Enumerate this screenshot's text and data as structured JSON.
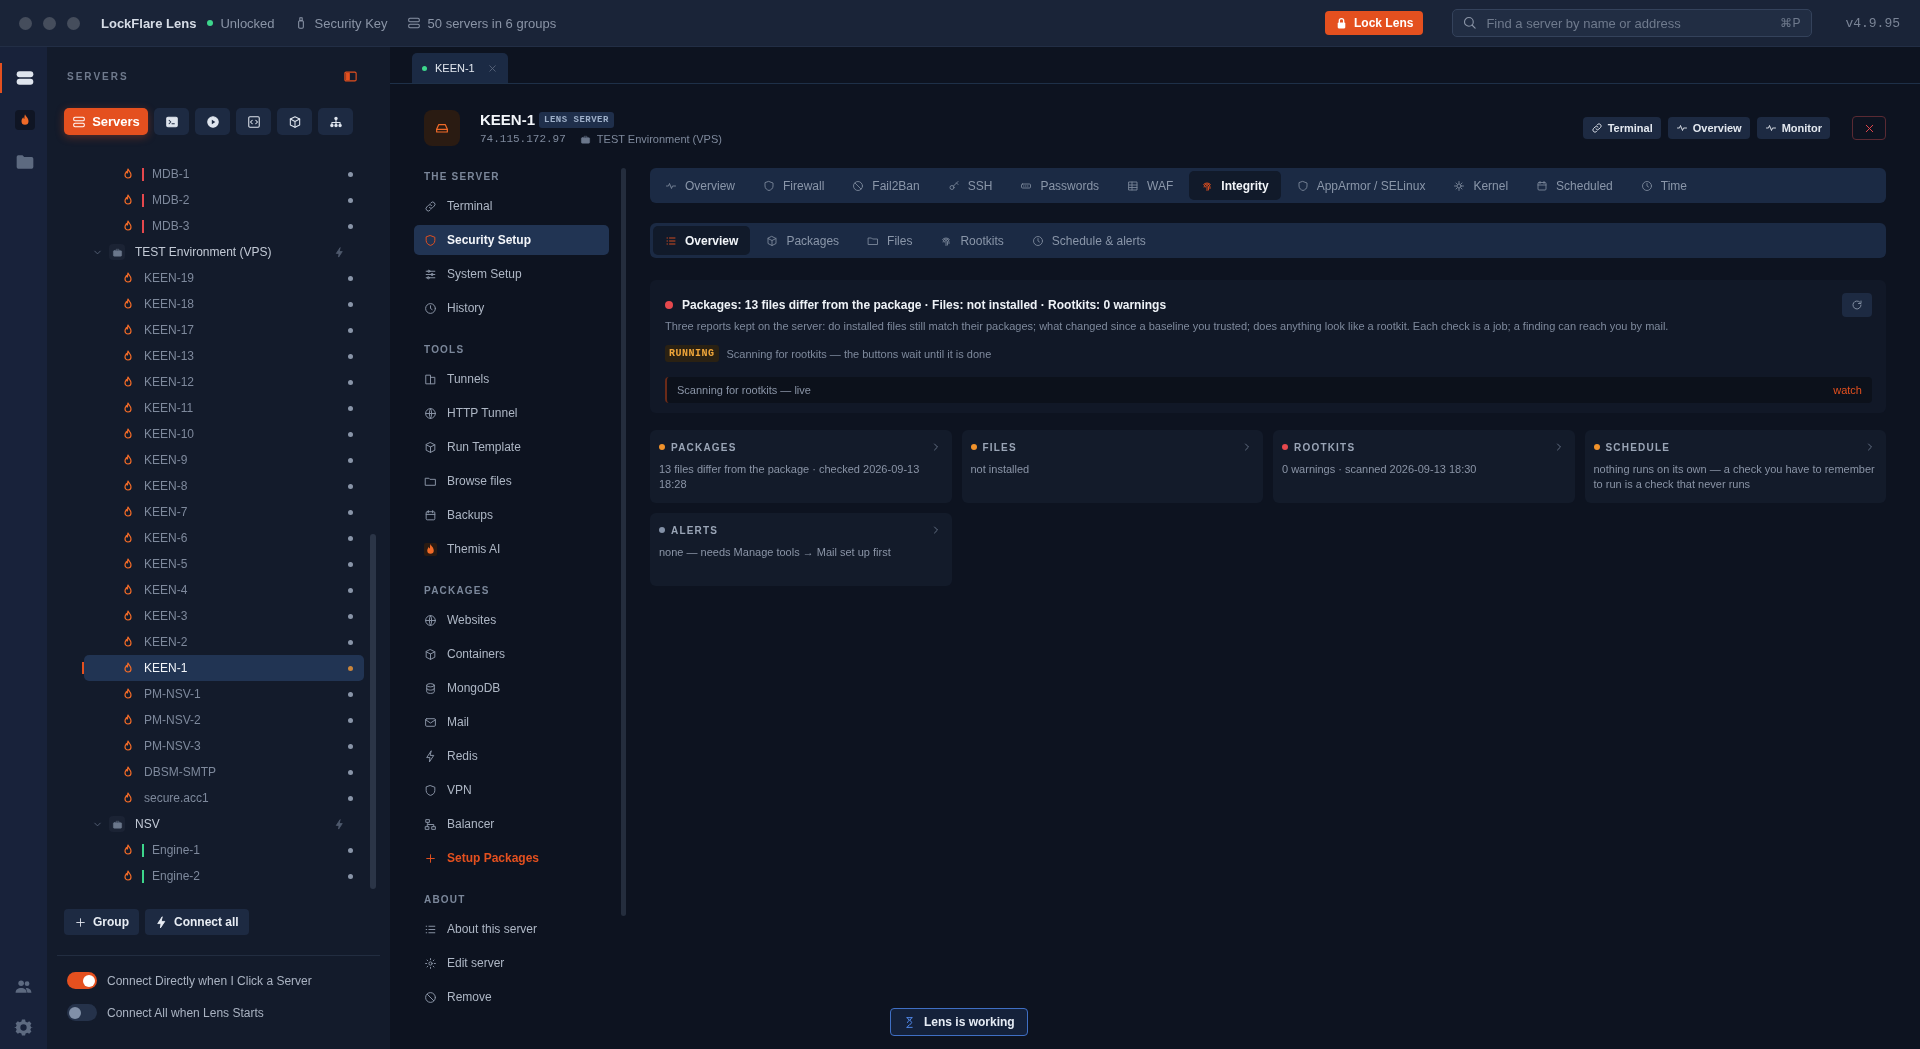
{
  "titlebar": {
    "app_name": "LockFlare Lens",
    "lock_status": "Unlocked",
    "security_key": "Security Key",
    "servers_summary": "50 servers in 6 groups",
    "lock_button": "Lock Lens",
    "search": {
      "placeholder": "Find a server by name or address",
      "shortcut": "⌘P"
    },
    "version": "v4.9.95"
  },
  "rail": [
    {
      "selected": true
    },
    {
      "selected": false
    },
    {
      "selected": false
    }
  ],
  "sidebar": {
    "title": "SERVERS",
    "tabs": [
      {
        "label": "Servers",
        "selected": true
      },
      {
        "selected": false
      },
      {
        "selected": false
      },
      {
        "selected": false
      },
      {
        "selected": false
      },
      {
        "selected": false
      }
    ],
    "tree": [
      {
        "kind": "server",
        "name": "MDB-1",
        "color": "#e5484d",
        "selected": false
      },
      {
        "kind": "server",
        "name": "MDB-2",
        "color": "#e5484d",
        "selected": false
      },
      {
        "kind": "server",
        "name": "MDB-3",
        "color": "#e5484d",
        "selected": false
      },
      {
        "kind": "group",
        "name": "TEST Environment (VPS)",
        "expanded": true,
        "children": [
          {
            "kind": "server",
            "name": "KEEN-19",
            "selected": false
          },
          {
            "kind": "server",
            "name": "KEEN-18",
            "selected": false
          },
          {
            "kind": "server",
            "name": "KEEN-17",
            "selected": false
          },
          {
            "kind": "server",
            "name": "KEEN-13",
            "selected": false
          },
          {
            "kind": "server",
            "name": "KEEN-12",
            "selected": false
          },
          {
            "kind": "server",
            "name": "KEEN-11",
            "selected": false
          },
          {
            "kind": "server",
            "name": "KEEN-10",
            "selected": false
          },
          {
            "kind": "server",
            "name": "KEEN-9",
            "selected": false
          },
          {
            "kind": "server",
            "name": "KEEN-8",
            "selected": false
          },
          {
            "kind": "server",
            "name": "KEEN-7",
            "selected": false
          },
          {
            "kind": "server",
            "name": "KEEN-6",
            "selected": false
          },
          {
            "kind": "server",
            "name": "KEEN-5",
            "selected": false
          },
          {
            "kind": "server",
            "name": "KEEN-4",
            "selected": false
          },
          {
            "kind": "server",
            "name": "KEEN-3",
            "selected": false
          },
          {
            "kind": "server",
            "name": "KEEN-2",
            "selected": false
          },
          {
            "kind": "server",
            "name": "KEEN-1",
            "selected": true
          },
          {
            "kind": "server",
            "name": "PM-NSV-1",
            "selected": false
          },
          {
            "kind": "server",
            "name": "PM-NSV-2",
            "selected": false
          },
          {
            "kind": "server",
            "name": "PM-NSV-3",
            "selected": false
          },
          {
            "kind": "server",
            "name": "DBSM-SMTP",
            "selected": false
          },
          {
            "kind": "server",
            "name": "secure.acc1",
            "selected": false
          }
        ]
      },
      {
        "kind": "group",
        "name": "NSV",
        "expanded": true,
        "children": [
          {
            "kind": "server",
            "name": "Engine-1",
            "color": "#3dd68c",
            "selected": false
          },
          {
            "kind": "server",
            "name": "Engine-2",
            "color": "#3dd68c",
            "selected": false
          }
        ]
      }
    ],
    "buttons": [
      "Group",
      "Connect all"
    ],
    "toggles": [
      {
        "label": "Connect Directly when I Click a Server",
        "on": true
      },
      {
        "label": "Connect All when Lens Starts",
        "on": false
      }
    ]
  },
  "open_tabs": [
    {
      "label": "KEEN-1",
      "selected": true
    }
  ],
  "server": {
    "name": "KEEN-1",
    "badge": "LENS SERVER",
    "address": "74.115.172.97",
    "group": "TEST Environment (VPS)",
    "actions": [
      "Terminal",
      "Overview",
      "Monitor"
    ]
  },
  "nav": [
    {
      "heading": "THE SERVER",
      "items": [
        {
          "label": "Terminal",
          "kind": "link",
          "selected": false
        },
        {
          "label": "Security Setup",
          "kind": "link",
          "selected": true
        },
        {
          "label": "System Setup",
          "kind": "link",
          "selected": false
        },
        {
          "label": "History",
          "kind": "link",
          "selected": false
        }
      ]
    },
    {
      "heading": "TOOLS",
      "items": [
        {
          "label": "Tunnels",
          "kind": "link",
          "selected": false
        },
        {
          "label": "HTTP Tunnel",
          "kind": "link",
          "selected": false
        },
        {
          "label": "Run Template",
          "kind": "link",
          "selected": false
        },
        {
          "label": "Browse files",
          "kind": "link",
          "selected": false
        },
        {
          "label": "Backups",
          "kind": "link",
          "selected": false
        },
        {
          "label": "Themis AI",
          "kind": "link",
          "selected": false
        }
      ]
    },
    {
      "heading": "PACKAGES",
      "items": [
        {
          "label": "Websites",
          "kind": "link",
          "selected": false
        },
        {
          "label": "Containers",
          "kind": "link",
          "selected": false
        },
        {
          "label": "MongoDB",
          "kind": "link",
          "selected": false
        },
        {
          "label": "Mail",
          "kind": "link",
          "selected": false
        },
        {
          "label": "Redis",
          "kind": "link",
          "selected": false
        },
        {
          "label": "VPN",
          "kind": "link",
          "selected": false
        },
        {
          "label": "Balancer",
          "kind": "link",
          "selected": false
        },
        {
          "label": "Setup Packages",
          "kind": "action",
          "selected": false
        }
      ]
    },
    {
      "heading": "ABOUT",
      "items": [
        {
          "label": "About this server",
          "kind": "link",
          "selected": false
        },
        {
          "label": "Edit server",
          "kind": "link",
          "selected": false
        },
        {
          "label": "Remove",
          "kind": "link",
          "selected": false
        }
      ]
    }
  ],
  "security_tabs": [
    {
      "label": "Overview",
      "selected": false
    },
    {
      "label": "Firewall",
      "selected": false
    },
    {
      "label": "Fail2Ban",
      "selected": false
    },
    {
      "label": "SSH",
      "selected": false
    },
    {
      "label": "Passwords",
      "selected": false
    },
    {
      "label": "WAF",
      "selected": false
    },
    {
      "label": "Integrity",
      "selected": true
    },
    {
      "label": "AppArmor / SELinux",
      "selected": false
    },
    {
      "label": "Kernel",
      "selected": false
    },
    {
      "label": "Scheduled",
      "selected": false
    },
    {
      "label": "Time",
      "selected": false
    }
  ],
  "integrity_tabs": [
    {
      "label": "Overview",
      "selected": true
    },
    {
      "label": "Packages",
      "selected": false
    },
    {
      "label": "Files",
      "selected": false
    },
    {
      "label": "Rootkits",
      "selected": false
    },
    {
      "label": "Schedule & alerts",
      "selected": false
    }
  ],
  "summary": {
    "color": "#e5484d",
    "headline": "Packages: 13 files differ from the package · Files: not installed · Rootkits: 0 warnings",
    "description": "Three reports kept on the server: do installed files still match their packages; what changed since a baseline you trusted; does anything look like a rootkit. Each check is a job; a finding can reach you by mail.",
    "job_state": "RUNNING",
    "job_text": "Scanning for rootkits — the buttons wait until it is done",
    "log_line": "Scanning for rootkits — live",
    "log_action": "watch"
  },
  "cards": [
    {
      "title": "PACKAGES",
      "color": "#f0922b",
      "text": "13 files differ from the package · checked 2026-09-13 18:28"
    },
    {
      "title": "FILES",
      "color": "#f0922b",
      "text": "not installed"
    },
    {
      "title": "ROOTKITS",
      "color": "#e5484d",
      "text": "0 warnings · scanned 2026-09-13 18:30"
    },
    {
      "title": "SCHEDULE",
      "color": "#f0922b",
      "text": "nothing runs on its own — a check you have to remember to run is a check that never runs"
    },
    {
      "title": "ALERTS",
      "color": "#8391a7",
      "text": "none — needs Manage tools → Mail set up first"
    }
  ],
  "toast": "Lens is working"
}
